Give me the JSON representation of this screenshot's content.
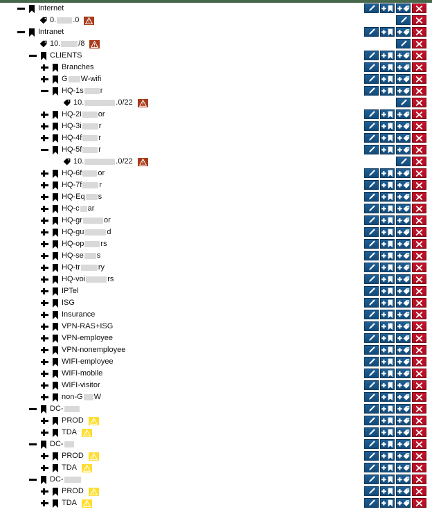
{
  "window": {
    "title": "IPAM Folder Tree",
    "topbar_color": "#46674a"
  },
  "colors": {
    "button_blue": "#16558a",
    "button_red": "#bb1127",
    "badge_brown": "#a83b1c",
    "badge_yellow": "#ffdd2e",
    "redaction": "#d9d9d9",
    "text": "#111111"
  },
  "icons": {
    "expand": "plus-icon",
    "collapse": "minus-icon",
    "folder": "bookmark-icon",
    "tag": "tag-icon",
    "warning": "warning-triangle-icon",
    "edit": "pencil-icon",
    "add_folder": "add-bookmark-icon",
    "add_tag": "add-tag-icon",
    "delete": "x-icon"
  },
  "buttons": {
    "edit_label": "Edit",
    "add_folder_label": "Add folder",
    "add_tag_label": "Add tag",
    "delete_label": "Delete"
  },
  "tree": {
    "rows": [
      {
        "id": "internet",
        "indent": 0,
        "toggle": "minus",
        "icon": "bookmark",
        "parts": [
          {
            "t": "Internet"
          }
        ],
        "badge": "none",
        "actions": "full"
      },
      {
        "id": "internet-subnet",
        "indent": 1,
        "toggle": "none",
        "icon": "tag",
        "parts": [
          {
            "t": "0."
          },
          {
            "r": 22
          },
          {
            "t": ".0"
          }
        ],
        "badge": "brown",
        "actions": "tag"
      },
      {
        "id": "intranet",
        "indent": 0,
        "toggle": "minus",
        "icon": "bookmark",
        "parts": [
          {
            "t": "Intranet"
          }
        ],
        "badge": "none",
        "actions": "full"
      },
      {
        "id": "intranet-subnet",
        "indent": 1,
        "toggle": "none",
        "icon": "tag",
        "parts": [
          {
            "t": "10."
          },
          {
            "r": 24
          },
          {
            "t": "/8"
          }
        ],
        "badge": "brown",
        "actions": "tag"
      },
      {
        "id": "clients",
        "indent": 1,
        "toggle": "minus",
        "icon": "bookmark",
        "parts": [
          {
            "t": "CLIENTS"
          }
        ],
        "badge": "none",
        "actions": "full"
      },
      {
        "id": "branches",
        "indent": 2,
        "toggle": "plus",
        "icon": "bookmark",
        "parts": [
          {
            "t": "Branches"
          }
        ],
        "badge": "none",
        "actions": "full"
      },
      {
        "id": "g-w-wifi",
        "indent": 2,
        "toggle": "plus",
        "icon": "bookmark",
        "parts": [
          {
            "t": "G"
          },
          {
            "r": 17
          },
          {
            "t": "W-wifi"
          }
        ],
        "badge": "none",
        "actions": "full"
      },
      {
        "id": "hq-1s",
        "indent": 2,
        "toggle": "minus",
        "icon": "bookmark",
        "parts": [
          {
            "t": "HQ-1s"
          },
          {
            "r": 22
          },
          {
            "t": "r"
          }
        ],
        "badge": "none",
        "actions": "full"
      },
      {
        "id": "hq-1s-subnet",
        "indent": 3,
        "toggle": "none",
        "icon": "tag",
        "parts": [
          {
            "t": "10."
          },
          {
            "r": 44
          },
          {
            "t": ".0/22"
          }
        ],
        "badge": "brown",
        "actions": "tag"
      },
      {
        "id": "hq-2",
        "indent": 2,
        "toggle": "plus",
        "icon": "bookmark",
        "parts": [
          {
            "t": "HQ-2i"
          },
          {
            "r": 22
          },
          {
            "t": "or"
          }
        ],
        "badge": "none",
        "actions": "full"
      },
      {
        "id": "hq-3",
        "indent": 2,
        "toggle": "plus",
        "icon": "bookmark",
        "parts": [
          {
            "t": "HQ-3i"
          },
          {
            "r": 23
          },
          {
            "t": "r"
          }
        ],
        "badge": "none",
        "actions": "full"
      },
      {
        "id": "hq-4",
        "indent": 2,
        "toggle": "plus",
        "icon": "bookmark",
        "parts": [
          {
            "t": "HQ-4f"
          },
          {
            "r": 22
          },
          {
            "t": "r"
          }
        ],
        "badge": "none",
        "actions": "full"
      },
      {
        "id": "hq-5",
        "indent": 2,
        "toggle": "minus",
        "icon": "bookmark",
        "parts": [
          {
            "t": "HQ-5f"
          },
          {
            "r": 22
          },
          {
            "t": "r"
          }
        ],
        "badge": "none",
        "actions": "full"
      },
      {
        "id": "hq-5-subnet",
        "indent": 3,
        "toggle": "none",
        "icon": "tag",
        "parts": [
          {
            "t": "10."
          },
          {
            "r": 44
          },
          {
            "t": ".0/22"
          }
        ],
        "badge": "brown",
        "actions": "tag"
      },
      {
        "id": "hq-6",
        "indent": 2,
        "toggle": "plus",
        "icon": "bookmark",
        "parts": [
          {
            "t": "HQ-6f"
          },
          {
            "r": 21
          },
          {
            "t": "or"
          }
        ],
        "badge": "none",
        "actions": "full"
      },
      {
        "id": "hq-7",
        "indent": 2,
        "toggle": "plus",
        "icon": "bookmark",
        "parts": [
          {
            "t": "HQ-7f"
          },
          {
            "r": 23
          },
          {
            "t": "r"
          }
        ],
        "badge": "none",
        "actions": "full"
      },
      {
        "id": "hq-eq",
        "indent": 2,
        "toggle": "plus",
        "icon": "bookmark",
        "parts": [
          {
            "t": "HQ-Eq"
          },
          {
            "r": 17
          },
          {
            "t": "s"
          }
        ],
        "badge": "none",
        "actions": "full"
      },
      {
        "id": "hq-c",
        "indent": 2,
        "toggle": "plus",
        "icon": "bookmark",
        "parts": [
          {
            "t": "HQ-c"
          },
          {
            "r": 10
          },
          {
            "t": "ar"
          }
        ],
        "badge": "none",
        "actions": "full"
      },
      {
        "id": "hq-gr",
        "indent": 2,
        "toggle": "plus",
        "icon": "bookmark",
        "parts": [
          {
            "t": "HQ-gr"
          },
          {
            "r": 29
          },
          {
            "t": "or"
          }
        ],
        "badge": "none",
        "actions": "full"
      },
      {
        "id": "hq-gu",
        "indent": 2,
        "toggle": "plus",
        "icon": "bookmark",
        "parts": [
          {
            "t": "HQ-gu"
          },
          {
            "r": 31
          },
          {
            "t": "d"
          }
        ],
        "badge": "none",
        "actions": "full"
      },
      {
        "id": "hq-ope",
        "indent": 2,
        "toggle": "plus",
        "icon": "bookmark",
        "parts": [
          {
            "t": "HQ-op"
          },
          {
            "r": 22
          },
          {
            "t": "rs"
          }
        ],
        "badge": "none",
        "actions": "full"
      },
      {
        "id": "hq-se",
        "indent": 2,
        "toggle": "plus",
        "icon": "bookmark",
        "parts": [
          {
            "t": "HQ-se"
          },
          {
            "r": 17
          },
          {
            "t": "s"
          }
        ],
        "badge": "none",
        "actions": "full"
      },
      {
        "id": "hq-tr",
        "indent": 2,
        "toggle": "plus",
        "icon": "bookmark",
        "parts": [
          {
            "t": "HQ-tr"
          },
          {
            "r": 24
          },
          {
            "t": "ry"
          }
        ],
        "badge": "none",
        "actions": "full"
      },
      {
        "id": "hq-voi",
        "indent": 2,
        "toggle": "plus",
        "icon": "bookmark",
        "parts": [
          {
            "t": "HQ-voi"
          },
          {
            "r": 30
          },
          {
            "t": "rs"
          }
        ],
        "badge": "none",
        "actions": "full"
      },
      {
        "id": "iptel",
        "indent": 2,
        "toggle": "plus",
        "icon": "bookmark",
        "parts": [
          {
            "t": "IPTel"
          }
        ],
        "badge": "none",
        "actions": "full"
      },
      {
        "id": "isg",
        "indent": 2,
        "toggle": "plus",
        "icon": "bookmark",
        "parts": [
          {
            "t": "ISG"
          }
        ],
        "badge": "none",
        "actions": "full"
      },
      {
        "id": "insurance",
        "indent": 2,
        "toggle": "plus",
        "icon": "bookmark",
        "parts": [
          {
            "t": "Insurance"
          }
        ],
        "badge": "none",
        "actions": "full"
      },
      {
        "id": "vpn-ras-isg",
        "indent": 2,
        "toggle": "plus",
        "icon": "bookmark",
        "parts": [
          {
            "t": "VPN-RAS+ISG"
          }
        ],
        "badge": "none",
        "actions": "full"
      },
      {
        "id": "vpn-employee",
        "indent": 2,
        "toggle": "plus",
        "icon": "bookmark",
        "parts": [
          {
            "t": "VPN-employee"
          }
        ],
        "badge": "none",
        "actions": "full"
      },
      {
        "id": "vpn-nonemployee",
        "indent": 2,
        "toggle": "plus",
        "icon": "bookmark",
        "parts": [
          {
            "t": "VPN-nonemployee"
          }
        ],
        "badge": "none",
        "actions": "full"
      },
      {
        "id": "wifi-employee",
        "indent": 2,
        "toggle": "plus",
        "icon": "bookmark",
        "parts": [
          {
            "t": "WIFI-employee"
          }
        ],
        "badge": "none",
        "actions": "full"
      },
      {
        "id": "wifi-mobile",
        "indent": 2,
        "toggle": "plus",
        "icon": "bookmark",
        "parts": [
          {
            "t": "WIFI-mobile"
          }
        ],
        "badge": "none",
        "actions": "full"
      },
      {
        "id": "wifi-visitor",
        "indent": 2,
        "toggle": "plus",
        "icon": "bookmark",
        "parts": [
          {
            "t": "WIFI-visitor"
          }
        ],
        "badge": "none",
        "actions": "full"
      },
      {
        "id": "non-g-w",
        "indent": 2,
        "toggle": "plus",
        "icon": "bookmark",
        "parts": [
          {
            "t": "non-G"
          },
          {
            "r": 14
          },
          {
            "t": "W"
          }
        ],
        "badge": "none",
        "actions": "full"
      },
      {
        "id": "dc-1",
        "indent": 1,
        "toggle": "minus",
        "icon": "bookmark",
        "parts": [
          {
            "t": "DC-"
          },
          {
            "r": 22
          }
        ],
        "badge": "none",
        "actions": "full"
      },
      {
        "id": "dc-1-prod",
        "indent": 2,
        "toggle": "plus",
        "icon": "bookmark",
        "parts": [
          {
            "t": "PROD"
          }
        ],
        "badge": "yellow",
        "actions": "full"
      },
      {
        "id": "dc-1-tda",
        "indent": 2,
        "toggle": "plus",
        "icon": "bookmark",
        "parts": [
          {
            "t": "TDA"
          }
        ],
        "badge": "yellow",
        "actions": "full"
      },
      {
        "id": "dc-2",
        "indent": 1,
        "toggle": "minus",
        "icon": "bookmark",
        "parts": [
          {
            "t": "DC-"
          },
          {
            "r": 14
          }
        ],
        "badge": "none",
        "actions": "full"
      },
      {
        "id": "dc-2-prod",
        "indent": 2,
        "toggle": "plus",
        "icon": "bookmark",
        "parts": [
          {
            "t": "PROD"
          }
        ],
        "badge": "yellow",
        "actions": "full"
      },
      {
        "id": "dc-2-tda",
        "indent": 2,
        "toggle": "plus",
        "icon": "bookmark",
        "parts": [
          {
            "t": "TDA"
          }
        ],
        "badge": "yellow",
        "actions": "full"
      },
      {
        "id": "dc-3",
        "indent": 1,
        "toggle": "minus",
        "icon": "bookmark",
        "parts": [
          {
            "t": "DC-"
          },
          {
            "r": 24
          }
        ],
        "badge": "none",
        "actions": "full"
      },
      {
        "id": "dc-3-prod",
        "indent": 2,
        "toggle": "plus",
        "icon": "bookmark",
        "parts": [
          {
            "t": "PROD"
          }
        ],
        "badge": "yellow",
        "actions": "full"
      },
      {
        "id": "dc-3-tda",
        "indent": 2,
        "toggle": "plus",
        "icon": "bookmark",
        "parts": [
          {
            "t": "TDA"
          }
        ],
        "badge": "yellow",
        "actions": "full"
      }
    ]
  }
}
